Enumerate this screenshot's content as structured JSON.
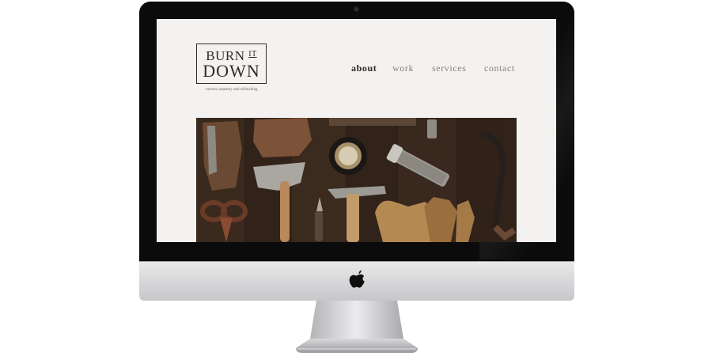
{
  "site": {
    "logo": {
      "line1": "BURN",
      "line1_small": "IT",
      "line2": "DOWN"
    },
    "tagline": "custom carpentry and refinishing",
    "nav": [
      {
        "label": "about",
        "active": true
      },
      {
        "label": "work",
        "active": false
      },
      {
        "label": "services",
        "active": false
      },
      {
        "label": "contact",
        "active": false
      }
    ],
    "hero": {
      "subject": "old hand tools on dark wood planks"
    }
  },
  "device": {
    "type": "desktop-monitor",
    "logo_icon": "apple-logo-icon"
  },
  "colors": {
    "page_bg": "#f4f2f0",
    "text_dark": "#2e2b29",
    "nav_muted": "#8b7e7a",
    "wood_dark": "#3a2a1f"
  }
}
